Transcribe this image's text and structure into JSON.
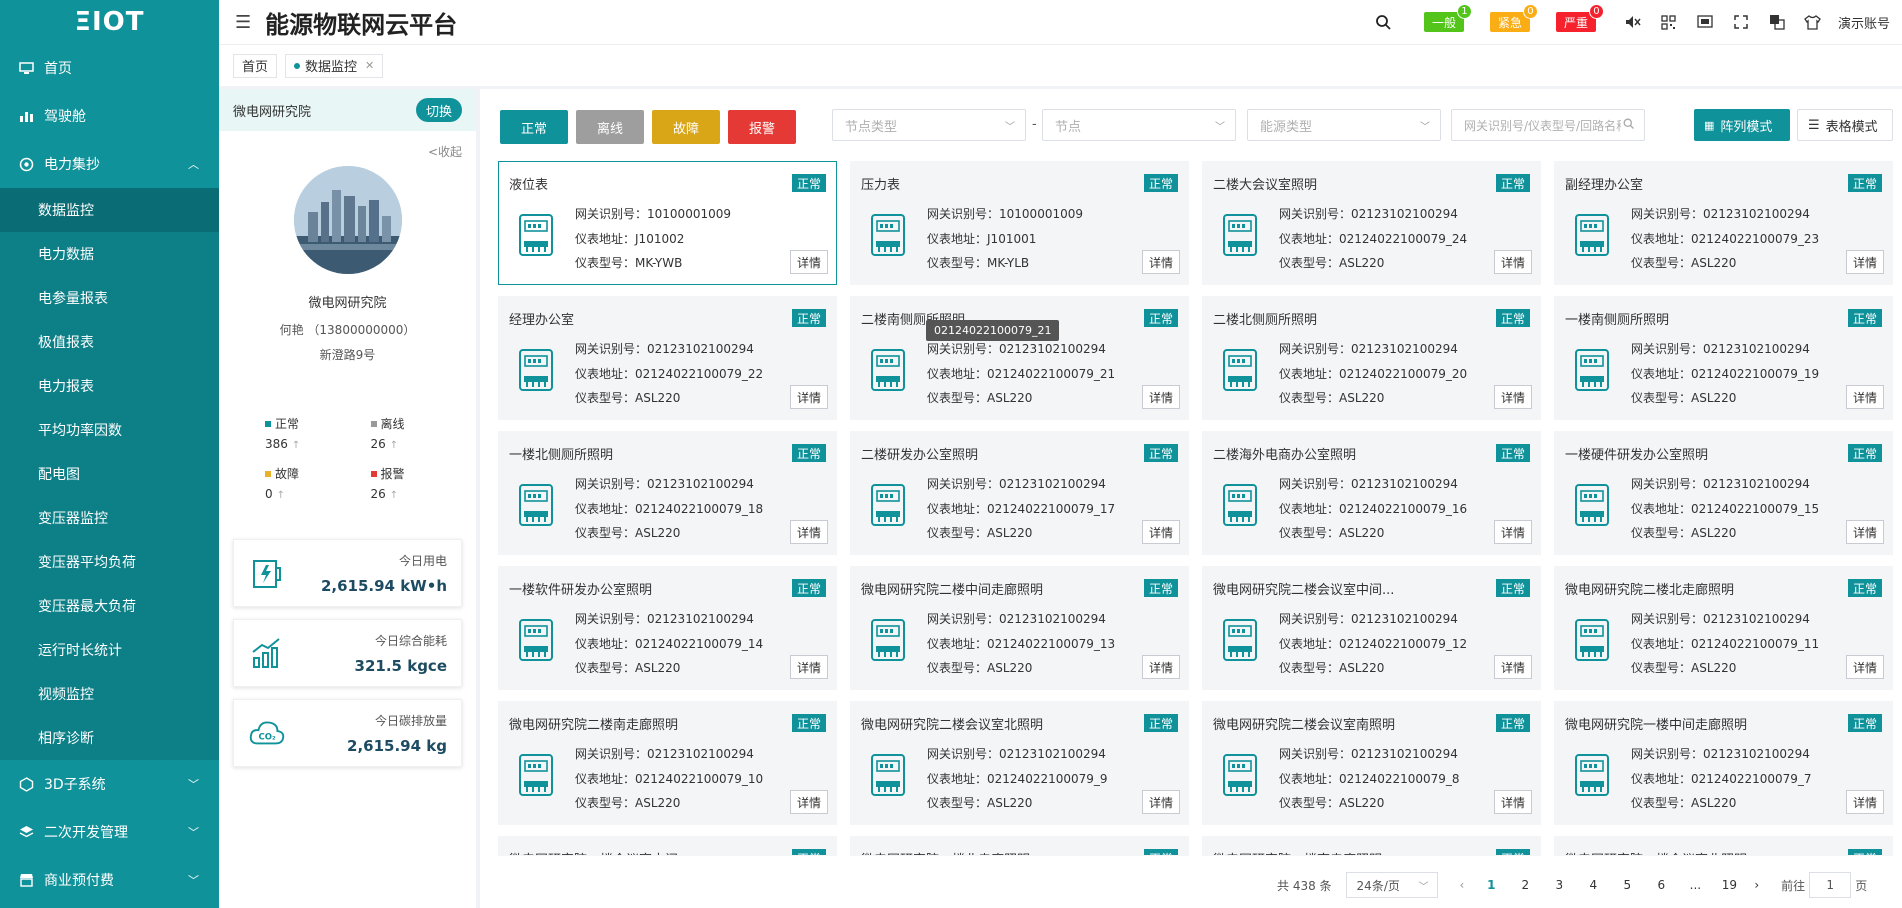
{
  "app": {
    "logo": "ΞIOT",
    "title": "能源物联网云平台"
  },
  "sidebar": {
    "items": [
      {
        "label": "首页",
        "icon": "monitor-icon"
      },
      {
        "label": "驾驶舱",
        "icon": "dashboard-icon"
      },
      {
        "label": "电力集抄",
        "icon": "power-icon"
      }
    ],
    "sub_items": [
      "数据监控",
      "电力数据",
      "电参量报表",
      "极值报表",
      "电力报表",
      "平均功率因数",
      "配电图",
      "变压器监控",
      "变压器平均负荷",
      "变压器最大负荷",
      "运行时长统计",
      "视频监控",
      "相序诊断"
    ],
    "bottom_items": [
      {
        "label": "3D子系统"
      },
      {
        "label": "二次开发管理"
      },
      {
        "label": "商业预付费"
      }
    ]
  },
  "header": {
    "alarms": [
      {
        "label": "一般",
        "count": "1",
        "color": "#52c41a"
      },
      {
        "label": "紧急",
        "count": "0",
        "color": "#faad14"
      },
      {
        "label": "严重",
        "count": "0",
        "color": "#f5222d"
      }
    ],
    "user": "演示账号"
  },
  "tabs": [
    {
      "label": "首页"
    },
    {
      "label": "数据监控"
    }
  ],
  "org": {
    "name": "微电网研究院",
    "switch_label": "切换",
    "collapse_label": "<收起",
    "display_name": "微电网研究院",
    "contact": "何艳 （13800000000）",
    "address": "新澄路9号"
  },
  "stats": [
    {
      "label": "正常",
      "value": "386",
      "color": "#10929a"
    },
    {
      "label": "离线",
      "value": "26",
      "color": "#999999"
    },
    {
      "label": "故障",
      "value": "0",
      "color": "#e8b32a"
    },
    {
      "label": "报警",
      "value": "26",
      "color": "#e53935"
    }
  ],
  "kpis": [
    {
      "label": "今日用电",
      "value": "2,615.94 kW•h"
    },
    {
      "label": "今日综合能耗",
      "value": "321.5 kgce"
    },
    {
      "label": "今日碳排放量",
      "value": "2,615.94 kg"
    }
  ],
  "filters": {
    "status_buttons": [
      {
        "label": "正常",
        "color": "#10929a"
      },
      {
        "label": "离线",
        "color": "#9e9e9e"
      },
      {
        "label": "故障",
        "color": "#d9a618"
      },
      {
        "label": "报警",
        "color": "#e53935"
      }
    ],
    "node_type_placeholder": "节点类型",
    "node_placeholder": "节点",
    "energy_type_placeholder": "能源类型",
    "search_placeholder": "网关识别号/仪表型号/回路名称",
    "separator": "-",
    "array_mode": "阵列模式",
    "table_mode": "表格模式"
  },
  "labels": {
    "gateway": "网关识别号：",
    "address": "仪表地址：",
    "model": "仪表型号：",
    "status": "正常",
    "detail": "详情"
  },
  "cards": [
    {
      "name": "液位表",
      "gateway": "10100001009",
      "address": "J101002",
      "model": "MK-YWB"
    },
    {
      "name": "压力表",
      "gateway": "10100001009",
      "address": "J101001",
      "model": "MK-YLB"
    },
    {
      "name": "二楼大会议室照明",
      "gateway": "02123102100294",
      "address": "02124022100079_24",
      "model": "ASL220"
    },
    {
      "name": "副经理办公室",
      "gateway": "02123102100294",
      "address": "02124022100079_23",
      "model": "ASL220"
    },
    {
      "name": "经理办公室",
      "gateway": "02123102100294",
      "address": "02124022100079_22",
      "model": "ASL220"
    },
    {
      "name": "二楼南侧厕所照明",
      "gateway": "02123102100294",
      "address": "02124022100079_21",
      "model": "ASL220"
    },
    {
      "name": "二楼北侧厕所照明",
      "gateway": "02123102100294",
      "address": "02124022100079_20",
      "model": "ASL220"
    },
    {
      "name": "一楼南侧厕所照明",
      "gateway": "02123102100294",
      "address": "02124022100079_19",
      "model": "ASL220"
    },
    {
      "name": "一楼北侧厕所照明",
      "gateway": "02123102100294",
      "address": "02124022100079_18",
      "model": "ASL220"
    },
    {
      "name": "二楼研发办公室照明",
      "gateway": "02123102100294",
      "address": "02124022100079_17",
      "model": "ASL220"
    },
    {
      "name": "二楼海外电商办公室照明",
      "gateway": "02123102100294",
      "address": "02124022100079_16",
      "model": "ASL220"
    },
    {
      "name": "一楼硬件研发办公室照明",
      "gateway": "02123102100294",
      "address": "02124022100079_15",
      "model": "ASL220"
    },
    {
      "name": "一楼软件研发办公室照明",
      "gateway": "02123102100294",
      "address": "02124022100079_14",
      "model": "ASL220"
    },
    {
      "name": "微电网研究院二楼中间走廊照明",
      "gateway": "02123102100294",
      "address": "02124022100079_13",
      "model": "ASL220"
    },
    {
      "name": "微电网研究院二楼会议室中间...",
      "gateway": "02123102100294",
      "address": "02124022100079_12",
      "model": "ASL220"
    },
    {
      "name": "微电网研究院二楼北走廊照明",
      "gateway": "02123102100294",
      "address": "02124022100079_11",
      "model": "ASL220"
    },
    {
      "name": "微电网研究院二楼南走廊照明",
      "gateway": "02123102100294",
      "address": "02124022100079_10",
      "model": "ASL220"
    },
    {
      "name": "微电网研究院二楼会议室北照明",
      "gateway": "02123102100294",
      "address": "02124022100079_9",
      "model": "ASL220"
    },
    {
      "name": "微电网研究院二楼会议室南照明",
      "gateway": "02123102100294",
      "address": "02124022100079_8",
      "model": "ASL220"
    },
    {
      "name": "微电网研究院一楼中间走廊照明",
      "gateway": "02123102100294",
      "address": "02124022100079_7",
      "model": "ASL220"
    },
    {
      "name": "微电网研究院一楼会议室中间",
      "gateway": "",
      "address": "",
      "model": ""
    },
    {
      "name": "微电网研究院一楼北走廊照明",
      "gateway": "",
      "address": "",
      "model": ""
    },
    {
      "name": "微电网研究院一楼南走廊照明",
      "gateway": "",
      "address": "",
      "model": ""
    },
    {
      "name": "微电网研究院一楼会议室北照明",
      "gateway": "",
      "address": "",
      "model": ""
    }
  ],
  "tooltip": "02124022100079_21",
  "pagination": {
    "total": "共 438 条",
    "page_size": "24条/页",
    "pages": [
      "1",
      "2",
      "3",
      "4",
      "5",
      "6",
      "...",
      "19"
    ],
    "current": "1",
    "goto_label": "前往",
    "goto_value": "1",
    "page_suffix": "页"
  }
}
